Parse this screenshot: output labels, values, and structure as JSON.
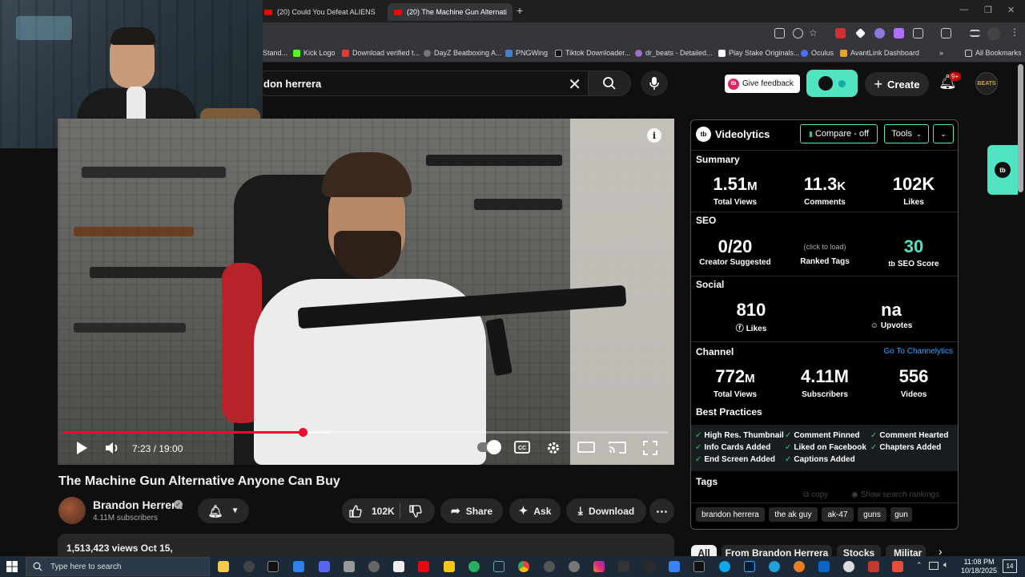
{
  "browser": {
    "tabs": [
      {
        "title": "(20) Could You Defeat ALIENS"
      },
      {
        "title": "(20) The Machine Gun Alternati"
      }
    ],
    "new_tab": "+",
    "bookmarks": [
      "Stand...",
      "Kick Logo",
      "Download verified t...",
      "DayZ Beatboxing A...",
      "PNGWing",
      "Tiktok Downloader...",
      "dr_beats - Detailed...",
      "Play Stake Originals...",
      "Oculus",
      "AvantLink Dashboard",
      "All Bookmarks"
    ],
    "bookmarks_more": "»"
  },
  "youtube": {
    "search_query": "don herrera",
    "feedback_label": "Give feedback",
    "create_label": "Create",
    "notif_count": "9+",
    "avatar_text": "BEATS"
  },
  "player": {
    "time_display": "7:23 / 19:00",
    "progress": 0.3947,
    "buffered": 0.44
  },
  "video": {
    "title": "The Machine Gun Alternative Anyone Can Buy",
    "channel_name": "Brandon Herrera",
    "verified_mark": "✓",
    "subscribers": "4.11M subscribers",
    "like_count": "102K",
    "share_label": "Share",
    "ask_label": "Ask",
    "download_label": "Download",
    "views_date": "1,513,423 views  Oct 15,"
  },
  "videolytics": {
    "title": "Videolytics",
    "logo_text": "tb",
    "compare_label": "Compare - off",
    "tools_label": "Tools",
    "summary_title": "Summary",
    "summary": [
      {
        "num": "1.51",
        "unit": "M",
        "label": "Total Views"
      },
      {
        "num": "11.3",
        "unit": "K",
        "label": "Comments"
      },
      {
        "num": "102K",
        "unit": "",
        "label": "Likes"
      }
    ],
    "seo_title": "SEO",
    "seo_creator_value": "0/20",
    "seo_creator_label": "Creator Suggested",
    "seo_tags_value": "(click to load)",
    "seo_tags_label": "Ranked Tags",
    "seo_score_value": "30",
    "seo_score_label": "SEO Score",
    "social_title": "Social",
    "social_likes_value": "810",
    "social_likes_label": "Likes",
    "social_upvotes_value": "na",
    "social_upvotes_label": "Upvotes",
    "channel_title": "Channel",
    "channel_link": "Go To Channelytics",
    "channel": [
      {
        "num": "772",
        "unit": "M",
        "label": "Total Views"
      },
      {
        "num": "4.11M",
        "unit": "",
        "label": "Subscribers"
      },
      {
        "num": "556",
        "unit": "",
        "label": "Videos"
      }
    ],
    "best_practices_title": "Best Practices",
    "best_practices": [
      "High Res. Thumbnail",
      "Comment Pinned",
      "Comment Hearted",
      "Info Cards Added",
      "Liked on Facebook",
      "Chapters Added",
      "End Screen Added",
      "Captions Added"
    ],
    "tags_title": "Tags",
    "copy_label": "copy",
    "show_rankings_label": "Show search rankings",
    "tags": [
      "brandon herrera",
      "the ak guy",
      "ak-47",
      "guns",
      "gun"
    ]
  },
  "chips": [
    "All",
    "From Brandon Herrera",
    "Stocks",
    "Militar"
  ],
  "taskbar": {
    "search_placeholder": "Type here to search",
    "time": "11:08 PM",
    "date": "10/18/2025",
    "notif": "14"
  },
  "colors": {
    "accent": "#50e3c2",
    "yt_red": "#ff0000",
    "progress": "#ff0033"
  }
}
